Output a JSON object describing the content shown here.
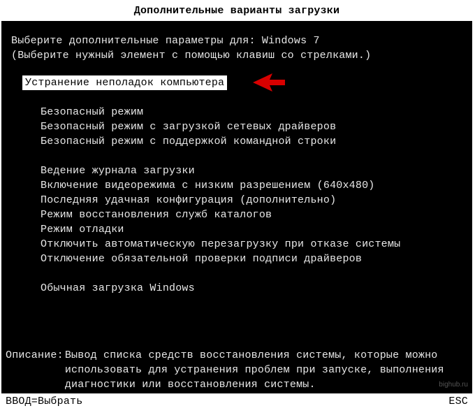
{
  "header": "Дополнительные варианты загрузки",
  "prompt_line": "Выберите дополнительные параметры для: Windows 7",
  "instruction_line": "(Выберите нужный элемент с помощью клавиш со стрелками.)",
  "selected_index": 0,
  "menu": {
    "group1": [
      "Устранение неполадок компьютера"
    ],
    "group2": [
      "Безопасный режим",
      "Безопасный режим с загрузкой сетевых драйверов",
      "Безопасный режим с поддержкой командной строки"
    ],
    "group3": [
      "Ведение журнала загрузки",
      "Включение видеорежима с низким разрешением (640x480)",
      "Последняя удачная конфигурация (дополнительно)",
      "Режим восстановления служб каталогов",
      "Режим отладки",
      "Отключить автоматическую перезагрузку при отказе системы",
      "Отключение обязательной проверки подписи драйверов"
    ],
    "group4": [
      "Обычная загрузка Windows"
    ]
  },
  "description": {
    "label": "Описание:",
    "text": "Вывод списка средств восстановления системы, которые можно использовать для устранения проблем при запуске, выполнения диагностики или восстановления системы."
  },
  "footer": {
    "left": "ВВОД=Выбрать",
    "right": "ESC"
  },
  "watermark": "bighub.ru"
}
